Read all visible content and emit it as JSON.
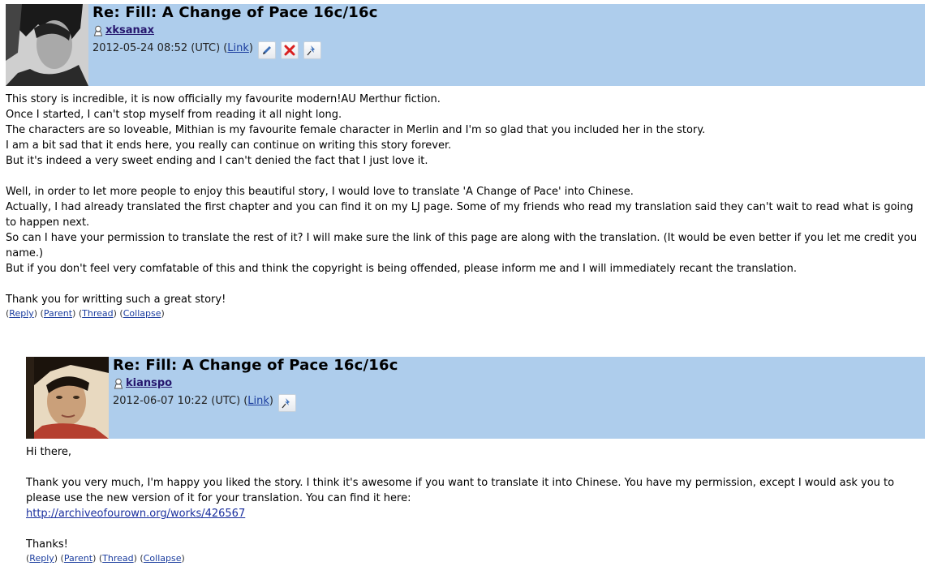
{
  "comments": [
    {
      "subject": "Re: Fill: A Change of Pace 16c/16c",
      "username": "xksanax",
      "date": "2012-05-24 08:52 (UTC)",
      "link_label": "Link",
      "body": [
        "This story is incredible, it is now officially my favourite modern!AU Merthur fiction.",
        "Once I started, I can't stop myself from reading it all night long.",
        "The characters are so loveable, Mithian is my favourite female character in Merlin and I'm so glad that you included her in the story.",
        "I am a bit sad that it ends here, you really can continue on writing this story forever.",
        "But it's indeed a very sweet ending and I can't denied the fact that I just love it.",
        "",
        "Well, in order to let more people to enjoy this beautiful story, I would love to translate 'A Change of Pace' into Chinese.",
        "Actually, I had already translated the first chapter and you can find it on my LJ page. Some of my friends who read my translation said they can't wait to read what is going to happen next.",
        "So can I have your permission to translate the rest of it? I will make sure the link of this page are along with the translation. (It would be even better if you let me credit you name.)",
        "But if you don't feel very comfatable of this and think the copyright is being offended, please inform me and I will immediately recant the translation.",
        "",
        "Thank you for writting such a great story!"
      ],
      "actions": [
        "Reply",
        "Parent",
        "Thread",
        "Collapse"
      ]
    },
    {
      "subject": "Re: Fill: A Change of Pace 16c/16c",
      "username": "kianspo",
      "date": "2012-06-07 10:22 (UTC)",
      "link_label": "Link",
      "greeting": "Hi there,",
      "body_text": "Thank you very much, I'm happy you liked the story. I think it's awesome if you want to translate it into Chinese. You have my permission, except I would ask you to please use the new version of it for your translation. You can find it here:",
      "url": "http://archiveofourown.org/works/426567",
      "closing": "Thanks!",
      "actions": [
        "Reply",
        "Parent",
        "Thread",
        "Collapse"
      ]
    }
  ]
}
